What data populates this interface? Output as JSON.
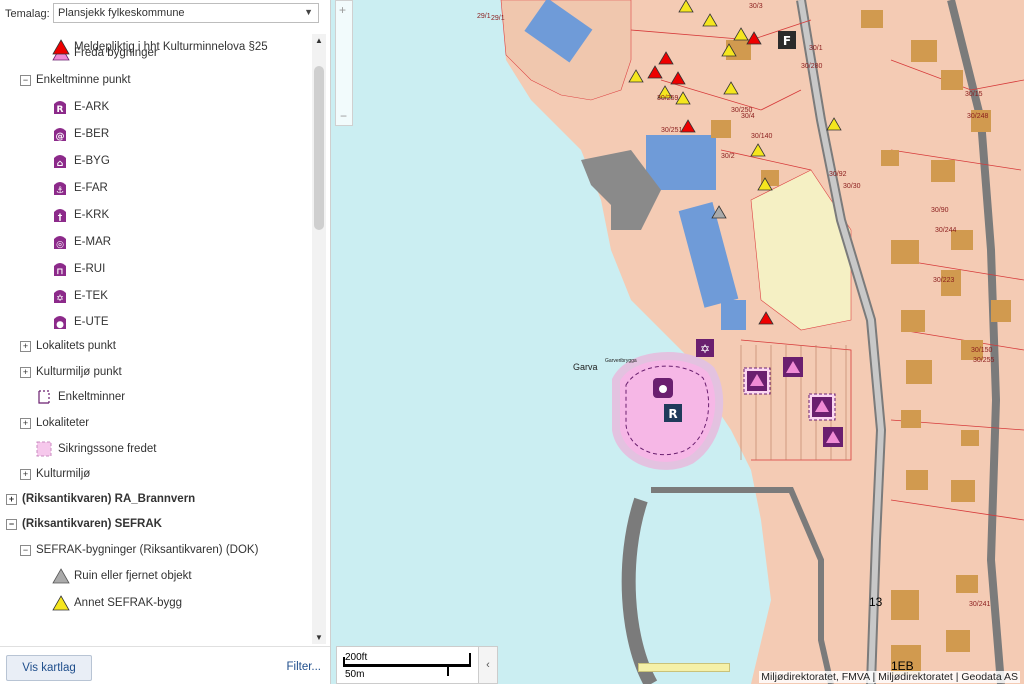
{
  "temalag": {
    "label": "Temalag:",
    "selected": "Plansjekk fylkeskommune"
  },
  "legend": [
    {
      "kind": "sym",
      "indent": 2,
      "icon": "triangle-pink-icon",
      "label": "Freda bygninger"
    },
    {
      "kind": "group",
      "indent": 1,
      "open": true,
      "label": "Enkeltminne punkt"
    },
    {
      "kind": "sym",
      "indent": 2,
      "icon": "e-ark-icon",
      "glyph": "R",
      "label": "E-ARK"
    },
    {
      "kind": "sym",
      "indent": 2,
      "icon": "e-ber-icon",
      "glyph": "@",
      "label": "E-BER"
    },
    {
      "kind": "sym",
      "indent": 2,
      "icon": "e-byg-icon",
      "glyph": "⌂",
      "label": "E-BYG"
    },
    {
      "kind": "sym",
      "indent": 2,
      "icon": "e-far-icon",
      "glyph": "⚓",
      "label": "E-FAR"
    },
    {
      "kind": "sym",
      "indent": 2,
      "icon": "e-krk-icon",
      "glyph": "†",
      "label": "E-KRK"
    },
    {
      "kind": "sym",
      "indent": 2,
      "icon": "e-mar-icon",
      "glyph": "◎",
      "label": "E-MAR"
    },
    {
      "kind": "sym",
      "indent": 2,
      "icon": "e-rui-icon",
      "glyph": "⊓",
      "label": "E-RUI"
    },
    {
      "kind": "sym",
      "indent": 2,
      "icon": "e-tek-icon",
      "glyph": "✡",
      "label": "E-TEK"
    },
    {
      "kind": "sym",
      "indent": 2,
      "icon": "e-ute-icon",
      "glyph": "●",
      "label": "E-UTE"
    },
    {
      "kind": "group",
      "indent": 1,
      "open": false,
      "label": "Lokalitets punkt"
    },
    {
      "kind": "group",
      "indent": 1,
      "open": false,
      "label": "Kulturmiljø punkt"
    },
    {
      "kind": "sym",
      "indent": 1,
      "icon": "enkeltminner-outline-icon",
      "label": "Enkeltminner"
    },
    {
      "kind": "group",
      "indent": 1,
      "open": false,
      "label": "Lokaliteter"
    },
    {
      "kind": "sym",
      "indent": 1,
      "icon": "sikringssone-icon",
      "label": "Sikringssone fredet"
    },
    {
      "kind": "group",
      "indent": 1,
      "open": false,
      "label": "Kulturmiljø"
    },
    {
      "kind": "group",
      "indent": 0,
      "open": false,
      "bold": true,
      "label": "(Riksantikvaren) RA_Brannvern"
    },
    {
      "kind": "group",
      "indent": 0,
      "open": true,
      "bold": true,
      "label": "(Riksantikvaren) SEFRAK"
    },
    {
      "kind": "group",
      "indent": 1,
      "open": true,
      "label": "SEFRAK-bygninger (Riksantikvaren) (DOK)"
    },
    {
      "kind": "sym",
      "indent": 2,
      "icon": "triangle-grey-icon",
      "label": "Ruin eller fjernet objekt"
    },
    {
      "kind": "sym",
      "indent": 2,
      "icon": "triangle-yellow-icon",
      "label": "Annet SEFRAK-bygg"
    },
    {
      "kind": "sym",
      "indent": 2,
      "icon": "triangle-red-icon",
      "label": "Meldepliktig i hht Kulturminnelova §25"
    }
  ],
  "footer": {
    "vis_button": "Vis kartlag",
    "filter_link": "Filter..."
  },
  "map": {
    "place_label": "Garva",
    "small_label": "Garveribrygga",
    "scale_ft": "200ft",
    "scale_m": "50m",
    "attribution": "Miljødirektoratet, FMVA | Miljødirektoratet | Geodata AS",
    "parcel_labels": [
      "29/1",
      "30/3",
      "30/1",
      "30/280",
      "30/250",
      "30/4",
      "30/140",
      "30/2",
      "30/92",
      "30/30",
      "30/90",
      "30/244",
      "30/15",
      "30/248",
      "30/223",
      "30/150",
      "30/255",
      "30/241",
      "30/259",
      "30/251",
      "29/1",
      "13",
      "1EB"
    ],
    "colors": {
      "water": "#cbeef2",
      "land": "#f4cbb4",
      "building": "#d19a4f",
      "blue_building": "#6f9bd8",
      "road": "#8a8a8a",
      "protection_zone": "#f6b7e6",
      "yellow_area": "#f5f0c4",
      "purple": "#6a1f6f"
    }
  }
}
